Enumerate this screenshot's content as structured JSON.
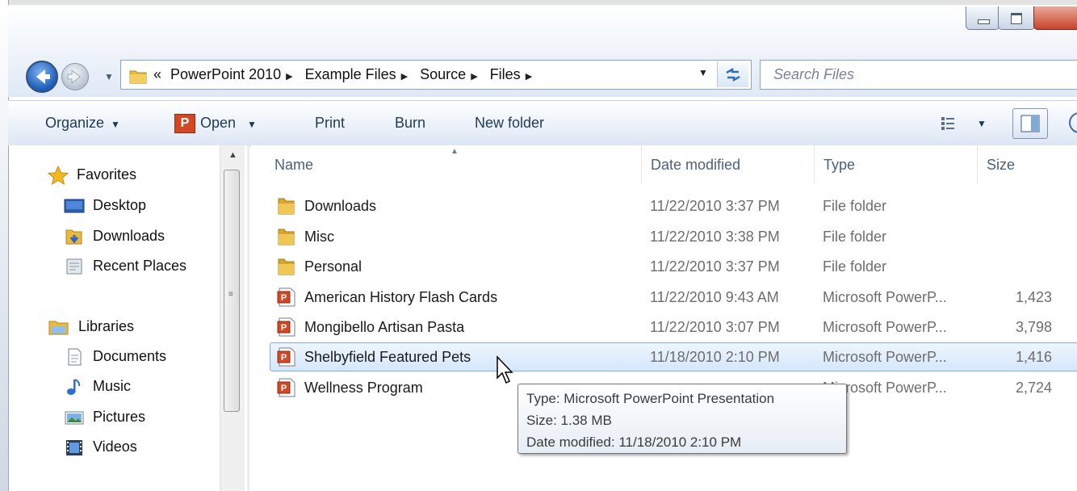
{
  "window": {
    "buttons": {
      "minimize": "minimize",
      "maximize": "maximize",
      "close": "close"
    }
  },
  "navigation": {
    "breadcrumb_prefix": "«",
    "breadcrumbs": [
      "PowerPoint 2010",
      "Example Files",
      "Source",
      "Files"
    ],
    "separator": "▶",
    "search_placeholder": "Search Files"
  },
  "toolbar": {
    "organize": "Organize",
    "open": "Open",
    "print": "Print",
    "burn": "Burn",
    "new_folder": "New folder",
    "dropdown_arrow": "▼"
  },
  "sidebar": {
    "favorites": {
      "label": "Favorites",
      "icon": "star-icon"
    },
    "favorites_items": [
      {
        "label": "Desktop",
        "icon": "desktop-icon"
      },
      {
        "label": "Downloads",
        "icon": "downloads-folder-icon"
      },
      {
        "label": "Recent Places",
        "icon": "recent-places-icon"
      }
    ],
    "libraries": {
      "label": "Libraries",
      "icon": "libraries-icon"
    },
    "libraries_items": [
      {
        "label": "Documents",
        "icon": "documents-icon"
      },
      {
        "label": "Music",
        "icon": "music-icon"
      },
      {
        "label": "Pictures",
        "icon": "pictures-icon"
      },
      {
        "label": "Videos",
        "icon": "videos-icon"
      }
    ]
  },
  "list": {
    "columns": {
      "name": "Name",
      "date": "Date modified",
      "type": "Type",
      "size": "Size"
    },
    "rows": [
      {
        "name": "Downloads",
        "date": "11/22/2010 3:37 PM",
        "type": "File folder",
        "size": "",
        "icon": "folder-icon"
      },
      {
        "name": "Misc",
        "date": "11/22/2010 3:38 PM",
        "type": "File folder",
        "size": "",
        "icon": "folder-icon"
      },
      {
        "name": "Personal",
        "date": "11/22/2010 3:37 PM",
        "type": "File folder",
        "size": "",
        "icon": "folder-icon"
      },
      {
        "name": "American History Flash Cards",
        "date": "11/22/2010 9:43 AM",
        "type": "Microsoft PowerP...",
        "size": "1,423",
        "icon": "powerpoint-file-icon"
      },
      {
        "name": "Mongibello Artisan Pasta",
        "date": "11/22/2010 3:07 PM",
        "type": "Microsoft PowerP...",
        "size": "3,798",
        "icon": "powerpoint-file-icon"
      },
      {
        "name": "Shelbyfield Featured Pets",
        "date": "11/18/2010 2:10 PM",
        "type": "Microsoft PowerP...",
        "size": "1,416",
        "icon": "powerpoint-file-icon",
        "selected": true
      },
      {
        "name": "Wellness Program",
        "date": "",
        "type": "Microsoft PowerP...",
        "size": "2,724",
        "icon": "powerpoint-file-icon"
      }
    ]
  },
  "tooltip": {
    "type": "Type: Microsoft PowerPoint Presentation",
    "size": "Size: 1.38 MB",
    "date": "Date modified: 11/18/2010 2:10 PM"
  },
  "colors": {
    "selection_fill": "#d5e7fb",
    "selection_border": "#84acdd",
    "toolbar_text": "#1e395b",
    "folder_yellow": "#e8b93a",
    "ppt_orange": "#d24726"
  }
}
